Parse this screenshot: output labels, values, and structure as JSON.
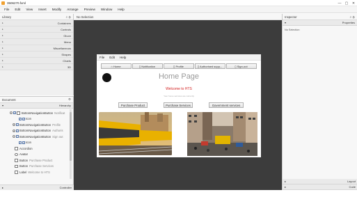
{
  "window": {
    "title": "3506270.fxml",
    "controls": [
      "—",
      "▢",
      "✕"
    ]
  },
  "menubar": [
    "File",
    "Edit",
    "View",
    "Insert",
    "Modify",
    "Arrange",
    "Preview",
    "Window",
    "Help"
  ],
  "library": {
    "title": "Library",
    "sections": [
      "Containers",
      "Controls",
      "Gluon",
      "Menu",
      "Miscellaneous",
      "Shapes",
      "Charts",
      "3D"
    ]
  },
  "document": {
    "title": "Document",
    "hierarchy_label": "Hierarchy",
    "rows": [
      {
        "kind": "node",
        "name": "BottomNavigationButton",
        "detail": "Notificat"
      },
      {
        "kind": "icon",
        "name": "Icon",
        "detail": ""
      },
      {
        "kind": "node",
        "name": "BottomNavigationButton",
        "detail": "Profile"
      },
      {
        "kind": "node",
        "name": "BottomNavigationButton",
        "detail": "Authoris"
      },
      {
        "kind": "node",
        "name": "BottomNavigationButton",
        "detail": "Sign out"
      },
      {
        "kind": "icon",
        "name": "Icon",
        "detail": ""
      },
      {
        "kind": "leaf",
        "name": "Accordion",
        "detail": ""
      },
      {
        "kind": "leaf",
        "name": "Avatar",
        "detail": ""
      },
      {
        "kind": "leaf",
        "name": "Button",
        "detail": "Purchase Product"
      },
      {
        "kind": "leaf",
        "name": "Button",
        "detail": "Purchase Services"
      },
      {
        "kind": "leaf",
        "name": "Label",
        "detail": "Welcome to HTS"
      }
    ],
    "controller_label": "Controller"
  },
  "canvas": {
    "selection_label": "No Selection"
  },
  "preview": {
    "menu": [
      "File",
      "Edit",
      "Help"
    ],
    "nav": [
      "Home",
      "Notification",
      "Profile",
      "Authorised supp...",
      "Sign-out"
    ],
    "heading": "Home Page",
    "welcome": "Welcome to HTS",
    "description": "Your home services are currently",
    "buttons": [
      "Purchase Product",
      "Purchase Services",
      "Government services"
    ]
  },
  "inspector": {
    "title": "Inspector",
    "properties_label": "Properties",
    "empty_text": "No Selection",
    "layout_label": "Layout",
    "code_label": "Code"
  },
  "colors": {
    "canvas_bg": "#3c3c3c",
    "welcome": "#d21c1c",
    "heading": "#9a9a9a"
  }
}
